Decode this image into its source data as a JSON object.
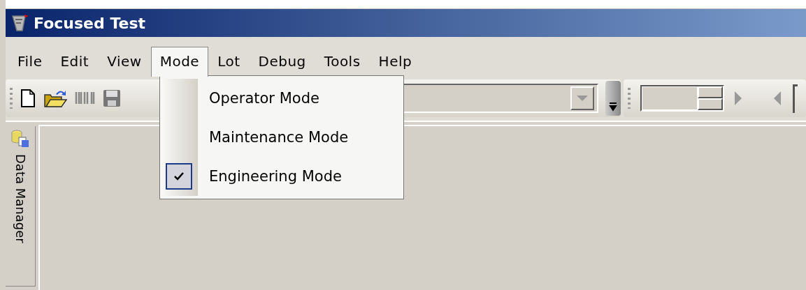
{
  "window": {
    "title": "Focused Test"
  },
  "menu": [
    {
      "label": "File",
      "selected": false
    },
    {
      "label": "Edit",
      "selected": false
    },
    {
      "label": "View",
      "selected": false
    },
    {
      "label": "Mode",
      "selected": true
    },
    {
      "label": "Lot",
      "selected": false
    },
    {
      "label": "Debug",
      "selected": false
    },
    {
      "label": "Tools",
      "selected": false
    },
    {
      "label": "Help",
      "selected": false
    }
  ],
  "mode_menu": [
    {
      "label": "Operator Mode",
      "checked": false
    },
    {
      "label": "Maintenance Mode",
      "checked": false
    },
    {
      "label": "Engineering Mode",
      "checked": true
    }
  ],
  "side_tab": {
    "label": "Data Manager"
  }
}
